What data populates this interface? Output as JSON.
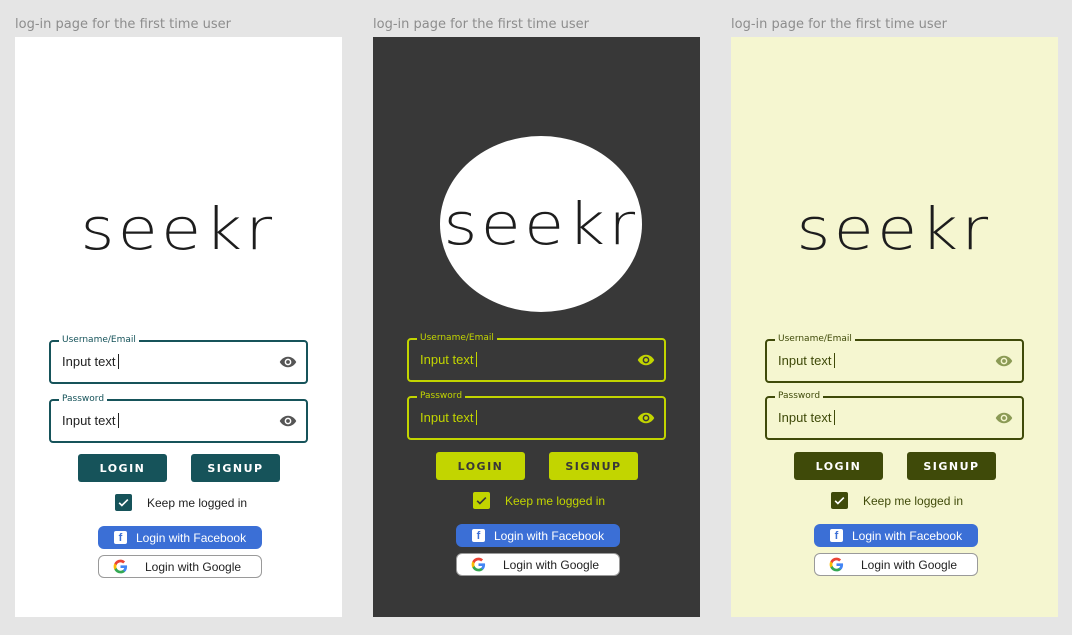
{
  "screens": [
    {
      "caption": "log-in page for the first time user",
      "logo": "seekr",
      "username": {
        "label": "Username/Email",
        "value": "Input text"
      },
      "password": {
        "label": "Password",
        "value": "Input text"
      },
      "login_label": "LOGIN",
      "signup_label": "SIGNUP",
      "keep_logged_in": {
        "label": "Keep me logged in",
        "checked": true
      },
      "facebook_label": "Login with Facebook",
      "google_label": "Login with Google",
      "colors": {
        "background": "#ffffff",
        "accent": "#16535a",
        "input_text": "#222222",
        "eye": "#555555"
      }
    },
    {
      "caption": "log-in page for the first time user",
      "logo": "seekr",
      "username": {
        "label": "Username/Email",
        "value": "Input text"
      },
      "password": {
        "label": "Password",
        "value": "Input text"
      },
      "login_label": "LOGIN",
      "signup_label": "SIGNUP",
      "keep_logged_in": {
        "label": "Keep me logged in",
        "checked": true
      },
      "facebook_label": "Login with Facebook",
      "google_label": "Login with Google",
      "colors": {
        "background": "#383838",
        "accent": "#c2d500",
        "input_text": "#c2d500",
        "eye": "#c2d500"
      }
    },
    {
      "caption": "log-in page for the first time user",
      "logo": "seekr",
      "username": {
        "label": "Username/Email",
        "value": "Input text"
      },
      "password": {
        "label": "Password",
        "value": "Input text"
      },
      "login_label": "LOGIN",
      "signup_label": "SIGNUP",
      "keep_logged_in": {
        "label": "Keep me logged in",
        "checked": true
      },
      "facebook_label": "Login with Facebook",
      "google_label": "Login with Google",
      "colors": {
        "background": "#f5f6d0",
        "accent": "#3f4a09",
        "input_text": "#3f4a09",
        "eye": "#8b9a55"
      }
    }
  ],
  "icons": {
    "visibility": "eye-icon",
    "checkbox": "checkmark-icon",
    "facebook": "facebook-icon",
    "google": "google-icon"
  }
}
